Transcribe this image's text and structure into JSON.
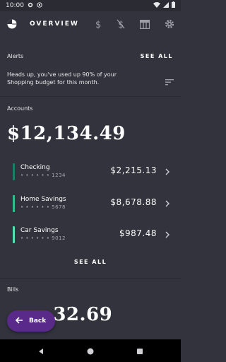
{
  "status": {
    "time": "10:00"
  },
  "header": {
    "title": "OVERVIEW"
  },
  "alerts": {
    "label": "Alerts",
    "see_all": "SEE ALL",
    "message": "Heads up, you've used up 90% of your Shopping budget for this month."
  },
  "accounts": {
    "label": "Accounts",
    "total": "$12,134.49",
    "items": [
      {
        "name": "Checking",
        "number": "• • • • • • 1234",
        "amount": "$2,215.13",
        "color": "#1d7f64"
      },
      {
        "name": "Home Savings",
        "number": "• • • • • • 5678",
        "amount": "$8,678.88",
        "color": "#2ec08b"
      },
      {
        "name": "Car Savings",
        "number": "• • • • • • 9012",
        "amount": "$987.48",
        "color": "#50e3b0"
      }
    ],
    "see_all": "SEE ALL"
  },
  "bills": {
    "label": "Bills",
    "total_visible": "$1,832.69",
    "amount_partial": "32.69"
  },
  "back_button": {
    "label": "Back"
  },
  "colors": {
    "background": "#33333d",
    "back_button": "#5a2a8a"
  }
}
